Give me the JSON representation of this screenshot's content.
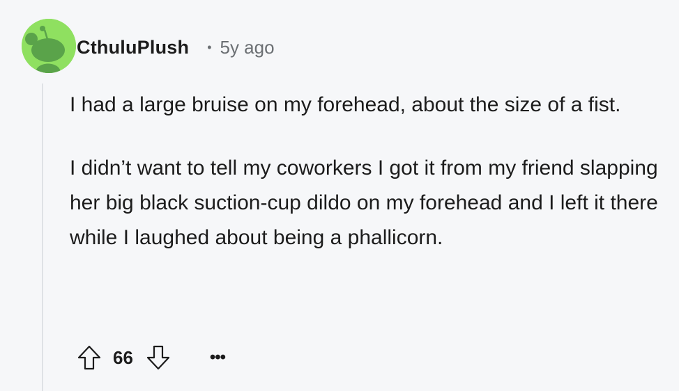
{
  "comment": {
    "username": "CthuluPlush",
    "separator": "•",
    "timestamp": "5y ago",
    "paragraphs": [
      "I had a large bruise on my forehead, about the size of a fist.",
      "I didn’t want to tell my coworkers I got it from my friend slapping her big black suction-cup dildo on my forehead and I left it there while I laughed about being a phallicorn."
    ],
    "score": "66",
    "more_label": "•••"
  },
  "icons": {
    "avatar": "reddit-snoo-avatar",
    "upvote": "upvote-arrow-icon",
    "downvote": "downvote-arrow-icon",
    "more": "more-options-icon"
  },
  "colors": {
    "background": "#f6f7f9",
    "avatar_bg": "#8fe060",
    "text": "#1c1c1c",
    "meta_text": "#6b6f73",
    "thread_line": "#dfe2e5"
  }
}
